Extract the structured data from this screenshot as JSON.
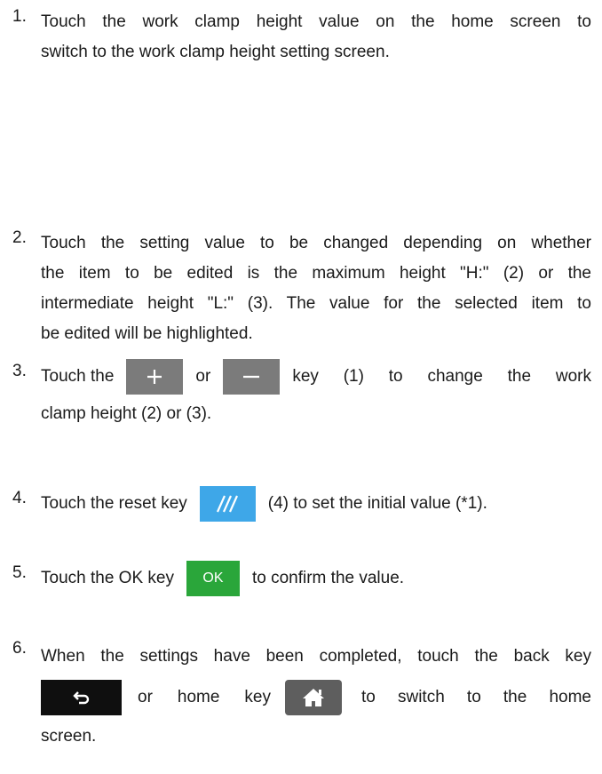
{
  "steps": [
    {
      "num": "1.",
      "line1": "Touch the work clamp height value on the home screen to",
      "line2": "switch to the work clamp height setting screen."
    },
    {
      "num": "2.",
      "line1": "Touch the setting value to be changed depending on whether",
      "line2": "the item to be edited is the maximum height \"H:\" (2) or the",
      "line3": "intermediate height \"L:\" (3). The value for the selected item to",
      "line4": "be edited will be highlighted."
    },
    {
      "num": "3.",
      "t1": "Touch the",
      "t2": "or",
      "t3": "key (1) to change the work",
      "line2": "clamp height (2) or (3)."
    },
    {
      "num": "4.",
      "t1": "Touch the reset key",
      "t2": "(4) to set the initial value (*1)."
    },
    {
      "num": "5.",
      "t1": "Touch the OK key",
      "t2": "to confirm the value.",
      "ok_label": "OK"
    },
    {
      "num": "6.",
      "line1": "When the settings have been completed, touch the back key",
      "t2": "or home key",
      "t3": "to switch to the home",
      "line3": "screen."
    }
  ],
  "icons": {
    "plus": "plus-icon",
    "minus": "minus-icon",
    "reset": "reset-icon",
    "back": "back-arrow-icon",
    "home": "home-icon"
  },
  "colors": {
    "plus_minus_key": "#7b7b7b",
    "reset_key": "#3ea7e8",
    "ok_key": "#2aa63a",
    "back_key": "#0f0f0f",
    "home_key": "#5e5e5e"
  }
}
